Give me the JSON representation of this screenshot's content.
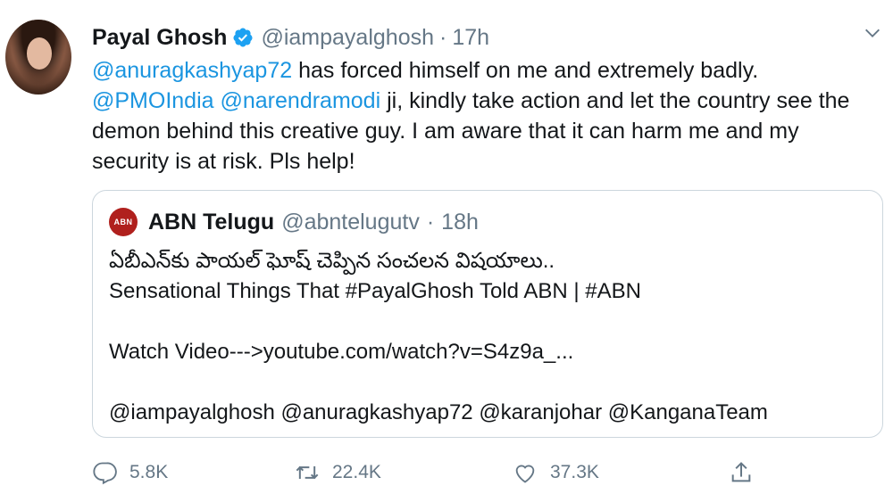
{
  "tweet": {
    "author_name": "Payal Ghosh",
    "handle": "@iampayalghosh",
    "separator": "·",
    "time": "17h",
    "lines": [
      [
        {
          "t": "@anuragkashyap72",
          "link": true
        },
        {
          "t": " has forced himself on me and extremely badly.",
          "link": false
        }
      ],
      [
        {
          "t": "@PMOIndia",
          "link": true
        },
        {
          "t": " ",
          "link": false
        },
        {
          "t": "@narendramodi",
          "link": true
        },
        {
          "t": " ji, kindly take action and let the country see the",
          "link": false
        }
      ],
      [
        {
          "t": "demon behind this creative guy. I am aware that it can harm me and my",
          "link": false
        }
      ],
      [
        {
          "t": "security is at risk. Pls help!",
          "link": false
        }
      ]
    ]
  },
  "quoted": {
    "avatar_text": "ABN",
    "name": "ABN Telugu",
    "handle": "@abntelugutv",
    "separator": "·",
    "time": "18h",
    "lines": [
      "ఏబీఎన్‌కు పాయల్ ఘోష్ చెప్పిన సంచలన విషయాలు..",
      "Sensational Things That #PayalGhosh Told ABN | #ABN",
      "",
      "Watch Video--->youtube.com/watch?v=S4z9a_...",
      "",
      "@iampayalghosh @anuragkashyap72 @karanjohar @KanganaTeam"
    ]
  },
  "actions": {
    "reply_count": "5.8K",
    "retweet_count": "22.4K",
    "like_count": "37.3K"
  },
  "icons": {
    "verified": "verified-badge-icon",
    "caret": "chevron-down-icon",
    "reply": "reply-icon",
    "retweet": "retweet-icon",
    "like": "heart-icon",
    "share": "share-icon"
  },
  "colors": {
    "link": "#1b95e0",
    "secondary": "#657786",
    "border": "#ccd6dd",
    "abn_red": "#b0201d"
  }
}
